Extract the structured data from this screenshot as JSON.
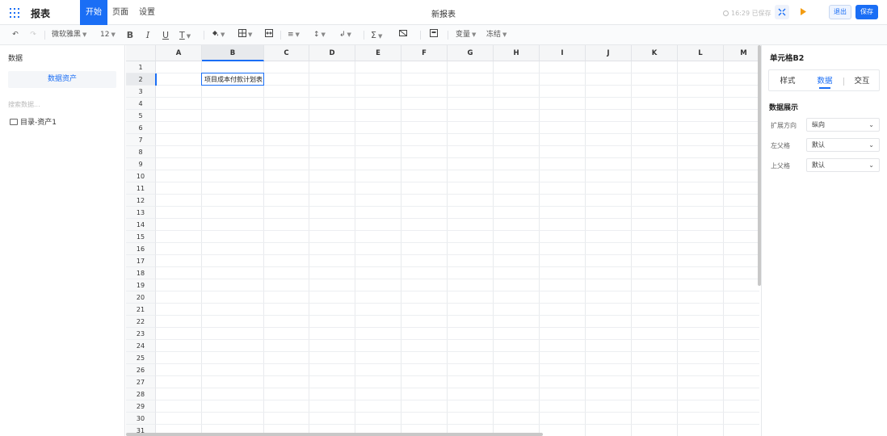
{
  "header": {
    "app_title": "报表",
    "nav_tabs": [
      {
        "label": "开始",
        "active": true
      },
      {
        "label": "页面",
        "active": false
      },
      {
        "label": "设置",
        "active": false
      }
    ],
    "doc_title": "新报表",
    "save_status": "16:29 已保存",
    "exit_label": "退出",
    "save_label": "保存",
    "accent_color": "#1a6ef5"
  },
  "toolbar": {
    "font_family": "微软雅黑",
    "font_size": "12",
    "variable_label": "变量",
    "freeze_label": "冻结"
  },
  "left_panel": {
    "title": "数据",
    "asset_button": "数据资产",
    "search_placeholder": "搜索数据...",
    "folder_label": "目录-资产1"
  },
  "sheet": {
    "columns": [
      "A",
      "B",
      "C",
      "D",
      "E",
      "F",
      "G",
      "H",
      "I",
      "J",
      "K",
      "L",
      "M"
    ],
    "rows": [
      "1",
      "2",
      "3",
      "4",
      "5",
      "6",
      "7",
      "8",
      "9",
      "10",
      "11",
      "12",
      "13",
      "14",
      "15",
      "16",
      "17",
      "18",
      "19",
      "20",
      "21",
      "22",
      "23",
      "24",
      "25",
      "26",
      "27",
      "28",
      "29",
      "30",
      "31"
    ],
    "selected_column": "B",
    "selected_row": "2",
    "cells": [
      {
        "ref": "B2",
        "value": "项目成本付款计划表"
      }
    ]
  },
  "right_panel": {
    "title": "单元格B2",
    "tabs": [
      {
        "label": "样式",
        "active": false
      },
      {
        "label": "数据",
        "active": true
      },
      {
        "label": "交互",
        "active": false
      }
    ],
    "section_title": "数据展示",
    "fields": [
      {
        "label": "扩展方向",
        "value": "纵向"
      },
      {
        "label": "左父格",
        "value": "默认"
      },
      {
        "label": "上父格",
        "value": "默认"
      }
    ]
  }
}
